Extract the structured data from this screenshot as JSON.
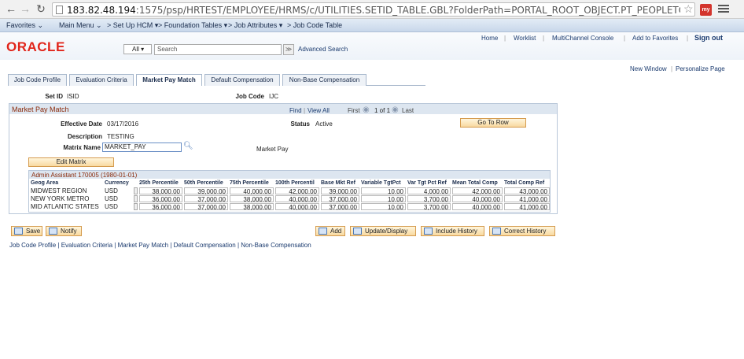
{
  "browser": {
    "url_host": "183.82.48.194",
    "url_rest": ":1575/psp/HRTEST/EMPLOYEE/HRMS/c/UTILITIES.SETID_TABLE.GBL?FolderPath=PORTAL_ROOT_OBJECT.PT_PEOPLETOOLS.PT_UTILITIES.PT_ADMINISTI",
    "ext_label": "my"
  },
  "menubar": {
    "favorites": "Favorites ⌄",
    "main_menu": "Main Menu ⌄",
    "crumb1": "> Set Up HCM ▾",
    "crumb2": "> Foundation Tables ▾",
    "crumb3": "> Job Attributes ▾",
    "crumb4": "> Job Code Table"
  },
  "header": {
    "logo": "ORACLE",
    "links": [
      "Home",
      "Worklist",
      "MultiChannel Console",
      "Add to Favorites"
    ],
    "signout": "Sign out",
    "search_scope": "All",
    "search_placeholder": "Search",
    "search_go": "≫",
    "advanced_search": "Advanced Search"
  },
  "page_links": {
    "new_window": "New Window",
    "personalize": "Personalize Page"
  },
  "tabs": [
    "Job Code Profile",
    "Evaluation Criteria",
    "Market Pay Match",
    "Default Compensation",
    "Non-Base Compensation"
  ],
  "keys": {
    "setid_label": "Set ID",
    "setid_value": "ISID",
    "jobcode_label": "Job Code",
    "jobcode_value": "IJC"
  },
  "group": {
    "title": "Market Pay Match",
    "nav_find": "Find",
    "nav_viewall": "View All",
    "nav_first": "First",
    "nav_count": "1 of 1",
    "nav_last": "Last",
    "effdate_label": "Effective Date",
    "effdate_value": "03/17/2016",
    "status_label": "Status",
    "status_value": "Active",
    "goto_row": "Go To Row",
    "desc_label": "Description",
    "desc_value": "TESTING",
    "matrix_label": "Matrix Name",
    "matrix_value": "MARKET_PAY",
    "matrix_desc": "Market Pay",
    "edit_matrix": "Edit Matrix"
  },
  "grid": {
    "caption": "Admin Assistant 170005  (1980-01-01)",
    "headers": [
      "Geog Area",
      "Currency",
      "25th Percentile",
      "50th Percentile",
      "75th Percentile",
      "100th Percentil",
      "Base Mkt Ref",
      "Variable TgtPct",
      "Var Tgt Pct Ref",
      "Mean Total Comp",
      "Total Comp Ref"
    ],
    "rows": [
      [
        "MIDWEST REGION",
        "USD",
        "38,000.00",
        "39,000.00",
        "40,000.00",
        "42,000.00",
        "39,000.00",
        "10.00",
        "4,000.00",
        "42,000.00",
        "43,000.00"
      ],
      [
        "NEW YORK METRO",
        "USD",
        "36,000.00",
        "37,000.00",
        "38,000.00",
        "40,000.00",
        "37,000.00",
        "10.00",
        "3,700.00",
        "40,000.00",
        "41,000.00"
      ],
      [
        "MID ATLANTIC STATES",
        "USD",
        "36,000.00",
        "37,000.00",
        "38,000.00",
        "40,000.00",
        "37,000.00",
        "10.00",
        "3,700.00",
        "40,000.00",
        "41,000.00"
      ]
    ]
  },
  "toolbar": {
    "save": "Save",
    "notify": "Notify",
    "add": "Add",
    "update": "Update/Display",
    "include_history": "Include History",
    "correct_history": "Correct History"
  },
  "footer_links": [
    "Job Code Profile",
    "Evaluation Criteria",
    "Market Pay Match",
    "Default Compensation",
    "Non-Base Compensation"
  ]
}
